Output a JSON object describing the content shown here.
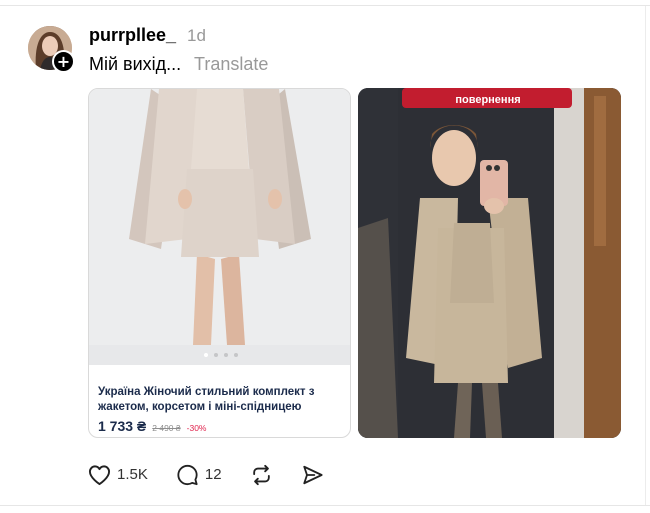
{
  "post": {
    "username": "purrpllee_",
    "time": "1d",
    "caption": "Мій вихід...",
    "translate_label": "Translate",
    "follow_symbol": "+"
  },
  "product": {
    "title": "Україна Жіночий стильний комплект з жакетом, корсетом і міні-спідницею",
    "price": "1 733 ₴",
    "old_price": "2 490 ₴",
    "discount": "-30%",
    "carousel_dots": 4,
    "carousel_active_index": 0
  },
  "photo_right": {
    "sign_text": "повернення"
  },
  "actions": {
    "likes": "1.5K",
    "comments": "12"
  },
  "colors": {
    "link_gray": "#999999",
    "price_navy": "#1b2b4b",
    "discount_red": "#e0244d"
  },
  "icons": [
    "heart-icon",
    "comment-icon",
    "repost-icon",
    "share-icon",
    "plus-icon"
  ]
}
